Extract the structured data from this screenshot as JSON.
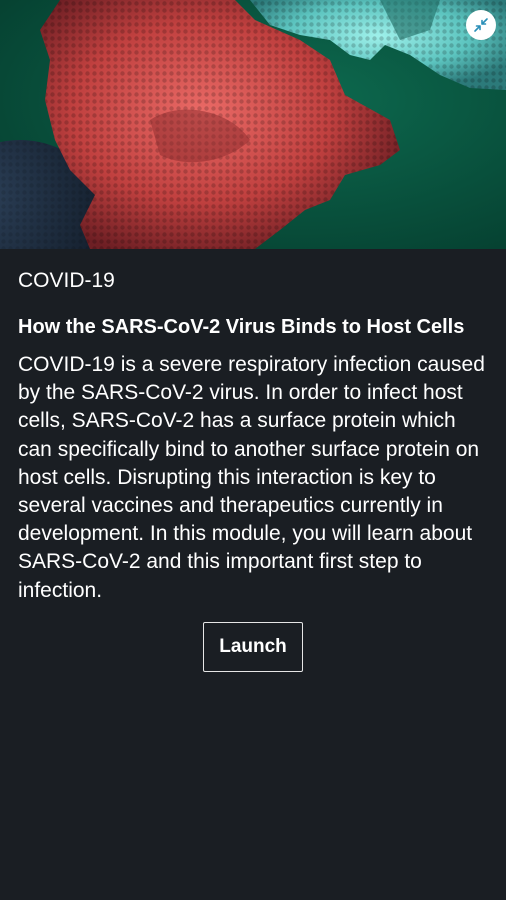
{
  "hero": {
    "image_icon": "protein-binding-illustration",
    "collapse_icon": "collapse-arrows-icon",
    "colors": {
      "background": "#06513c",
      "spike_protein": "#c8484a",
      "receptor_protein": "#5fc9c4",
      "virus_surface": "#1c2c3e"
    }
  },
  "card": {
    "category": "COVID-19",
    "title": "How the SARS-CoV-2 Virus Binds to Host Cells",
    "description": "COVID-19 is a severe respiratory infection caused by the SARS-CoV-2 virus.  In order to infect host cells, SARS-CoV-2 has a surface protein which can specifically bind to another surface protein on host cells.  Disrupting this interaction is key to several vaccines and therapeutics currently in development.  In this module, you will learn about SARS-CoV-2 and this important first step to infection.",
    "launch_label": "Launch"
  },
  "theme": {
    "background": "#1a1e23",
    "text": "#ffffff"
  }
}
